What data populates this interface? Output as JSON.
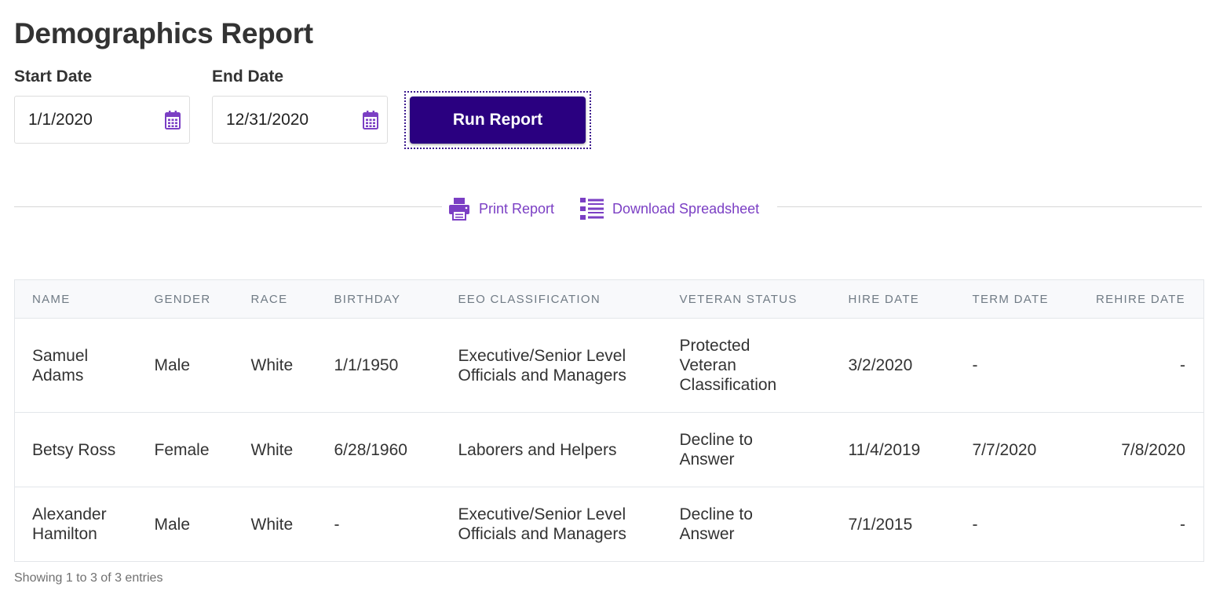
{
  "page": {
    "title": "Demographics Report"
  },
  "form": {
    "start_label": "Start Date",
    "start_value": "1/1/2020",
    "end_label": "End Date",
    "end_value": "12/31/2020",
    "run_label": "Run Report"
  },
  "actions": {
    "print_label": "Print Report",
    "download_label": "Download Spreadsheet"
  },
  "colors": {
    "accent": "#7b3fc4",
    "button": "#2a0080",
    "text": "#333333",
    "header_text": "#707b85"
  },
  "icons": {
    "date": "calendar-icon",
    "print": "printer-icon",
    "download": "list-icon"
  },
  "table": {
    "headers": [
      "NAME",
      "GENDER",
      "RACE",
      "BIRTHDAY",
      "EEO CLASSIFICATION",
      "VETERAN STATUS",
      "HIRE DATE",
      "TERM DATE",
      "REHIRE DATE"
    ],
    "rows": [
      [
        "Samuel Adams",
        "Male",
        "White",
        "1/1/1950",
        "Executive/Senior Level Officials and Managers",
        "Protected Veteran Classification",
        "3/2/2020",
        "-",
        "-"
      ],
      [
        "Betsy Ross",
        "Female",
        "White",
        "6/28/1960",
        "Laborers and Helpers",
        "Decline to Answer",
        "11/4/2019",
        "7/7/2020",
        "7/8/2020"
      ],
      [
        "Alexander Hamilton",
        "Male",
        "White",
        "-",
        "Executive/Senior Level Officials and Managers",
        "Decline to Answer",
        "7/1/2015",
        "-",
        "-"
      ]
    ]
  },
  "footer": {
    "info": "Showing 1 to 3 of 3 entries"
  }
}
